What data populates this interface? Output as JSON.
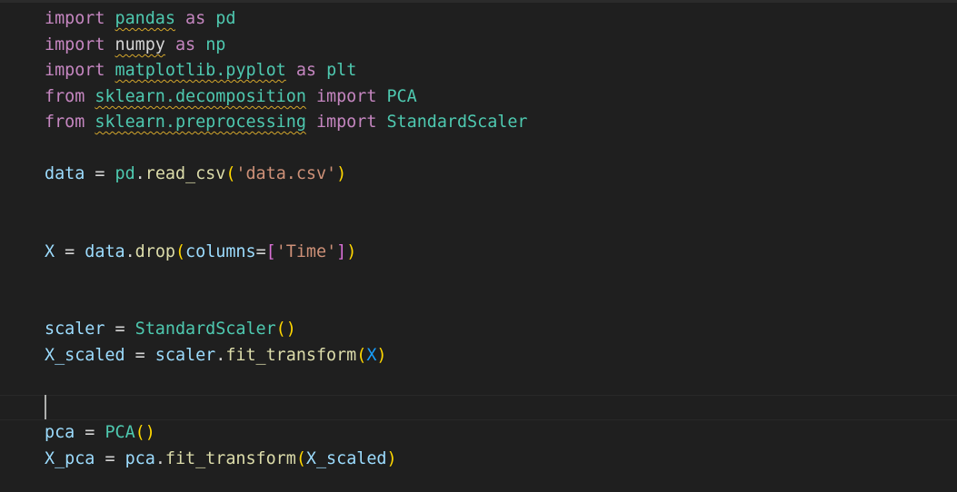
{
  "editor": {
    "language": "python",
    "lines": {
      "l1": {
        "kw": "import",
        "mod": "pandas",
        "as": "as",
        "alias": "pd"
      },
      "l2": {
        "kw": "import",
        "mod": "numpy",
        "as": "as",
        "alias": "np"
      },
      "l3": {
        "kw": "import",
        "mod": "matplotlib.pyplot",
        "as": "as",
        "alias": "plt"
      },
      "l4": {
        "kw": "from",
        "mod": "sklearn.decomposition",
        "imp": "import",
        "name": "PCA"
      },
      "l5": {
        "kw": "from",
        "mod": "sklearn.preprocessing",
        "imp": "import",
        "name": "StandardScaler"
      },
      "l6": {
        "var": "data",
        "eq": " = ",
        "obj": "pd",
        "dot": ".",
        "fn": "read_csv",
        "open": "(",
        "arg": "'data.csv'",
        "close": ")"
      },
      "l7": {
        "var": "X",
        "eq": " = ",
        "obj": "data",
        "dot": ".",
        "fn": "drop",
        "open": "(",
        "param": "columns",
        "peq": "=",
        "lb": "[",
        "arg": "'Time'",
        "rb": "]",
        "close": ")"
      },
      "l8": {
        "var": "scaler",
        "eq": " = ",
        "cls": "StandardScaler",
        "open": "(",
        "close": ")"
      },
      "l9": {
        "var": "X_scaled",
        "eq": " = ",
        "obj": "scaler",
        "dot": ".",
        "fn": "fit_transform",
        "open": "(",
        "arg": "X",
        "close": ")"
      },
      "l10": {
        "var": "pca",
        "eq": " = ",
        "cls": "PCA",
        "open": "(",
        "close": ")"
      },
      "l11": {
        "var": "X_pca",
        "eq": " = ",
        "obj": "pca",
        "dot": ".",
        "fn": "fit_transform",
        "open": "(",
        "arg": "X_scaled",
        "close": ")"
      }
    },
    "colors": {
      "background": "#1f1f1f",
      "keyword": "#c586c0",
      "module": "#4ec9b0",
      "variable": "#9cdcfe",
      "function": "#dcdcaa",
      "string": "#ce9178",
      "bracket_level1": "#ffd700",
      "bracket_level2": "#da70d6",
      "warning_squiggle": "#d4a72c"
    }
  }
}
